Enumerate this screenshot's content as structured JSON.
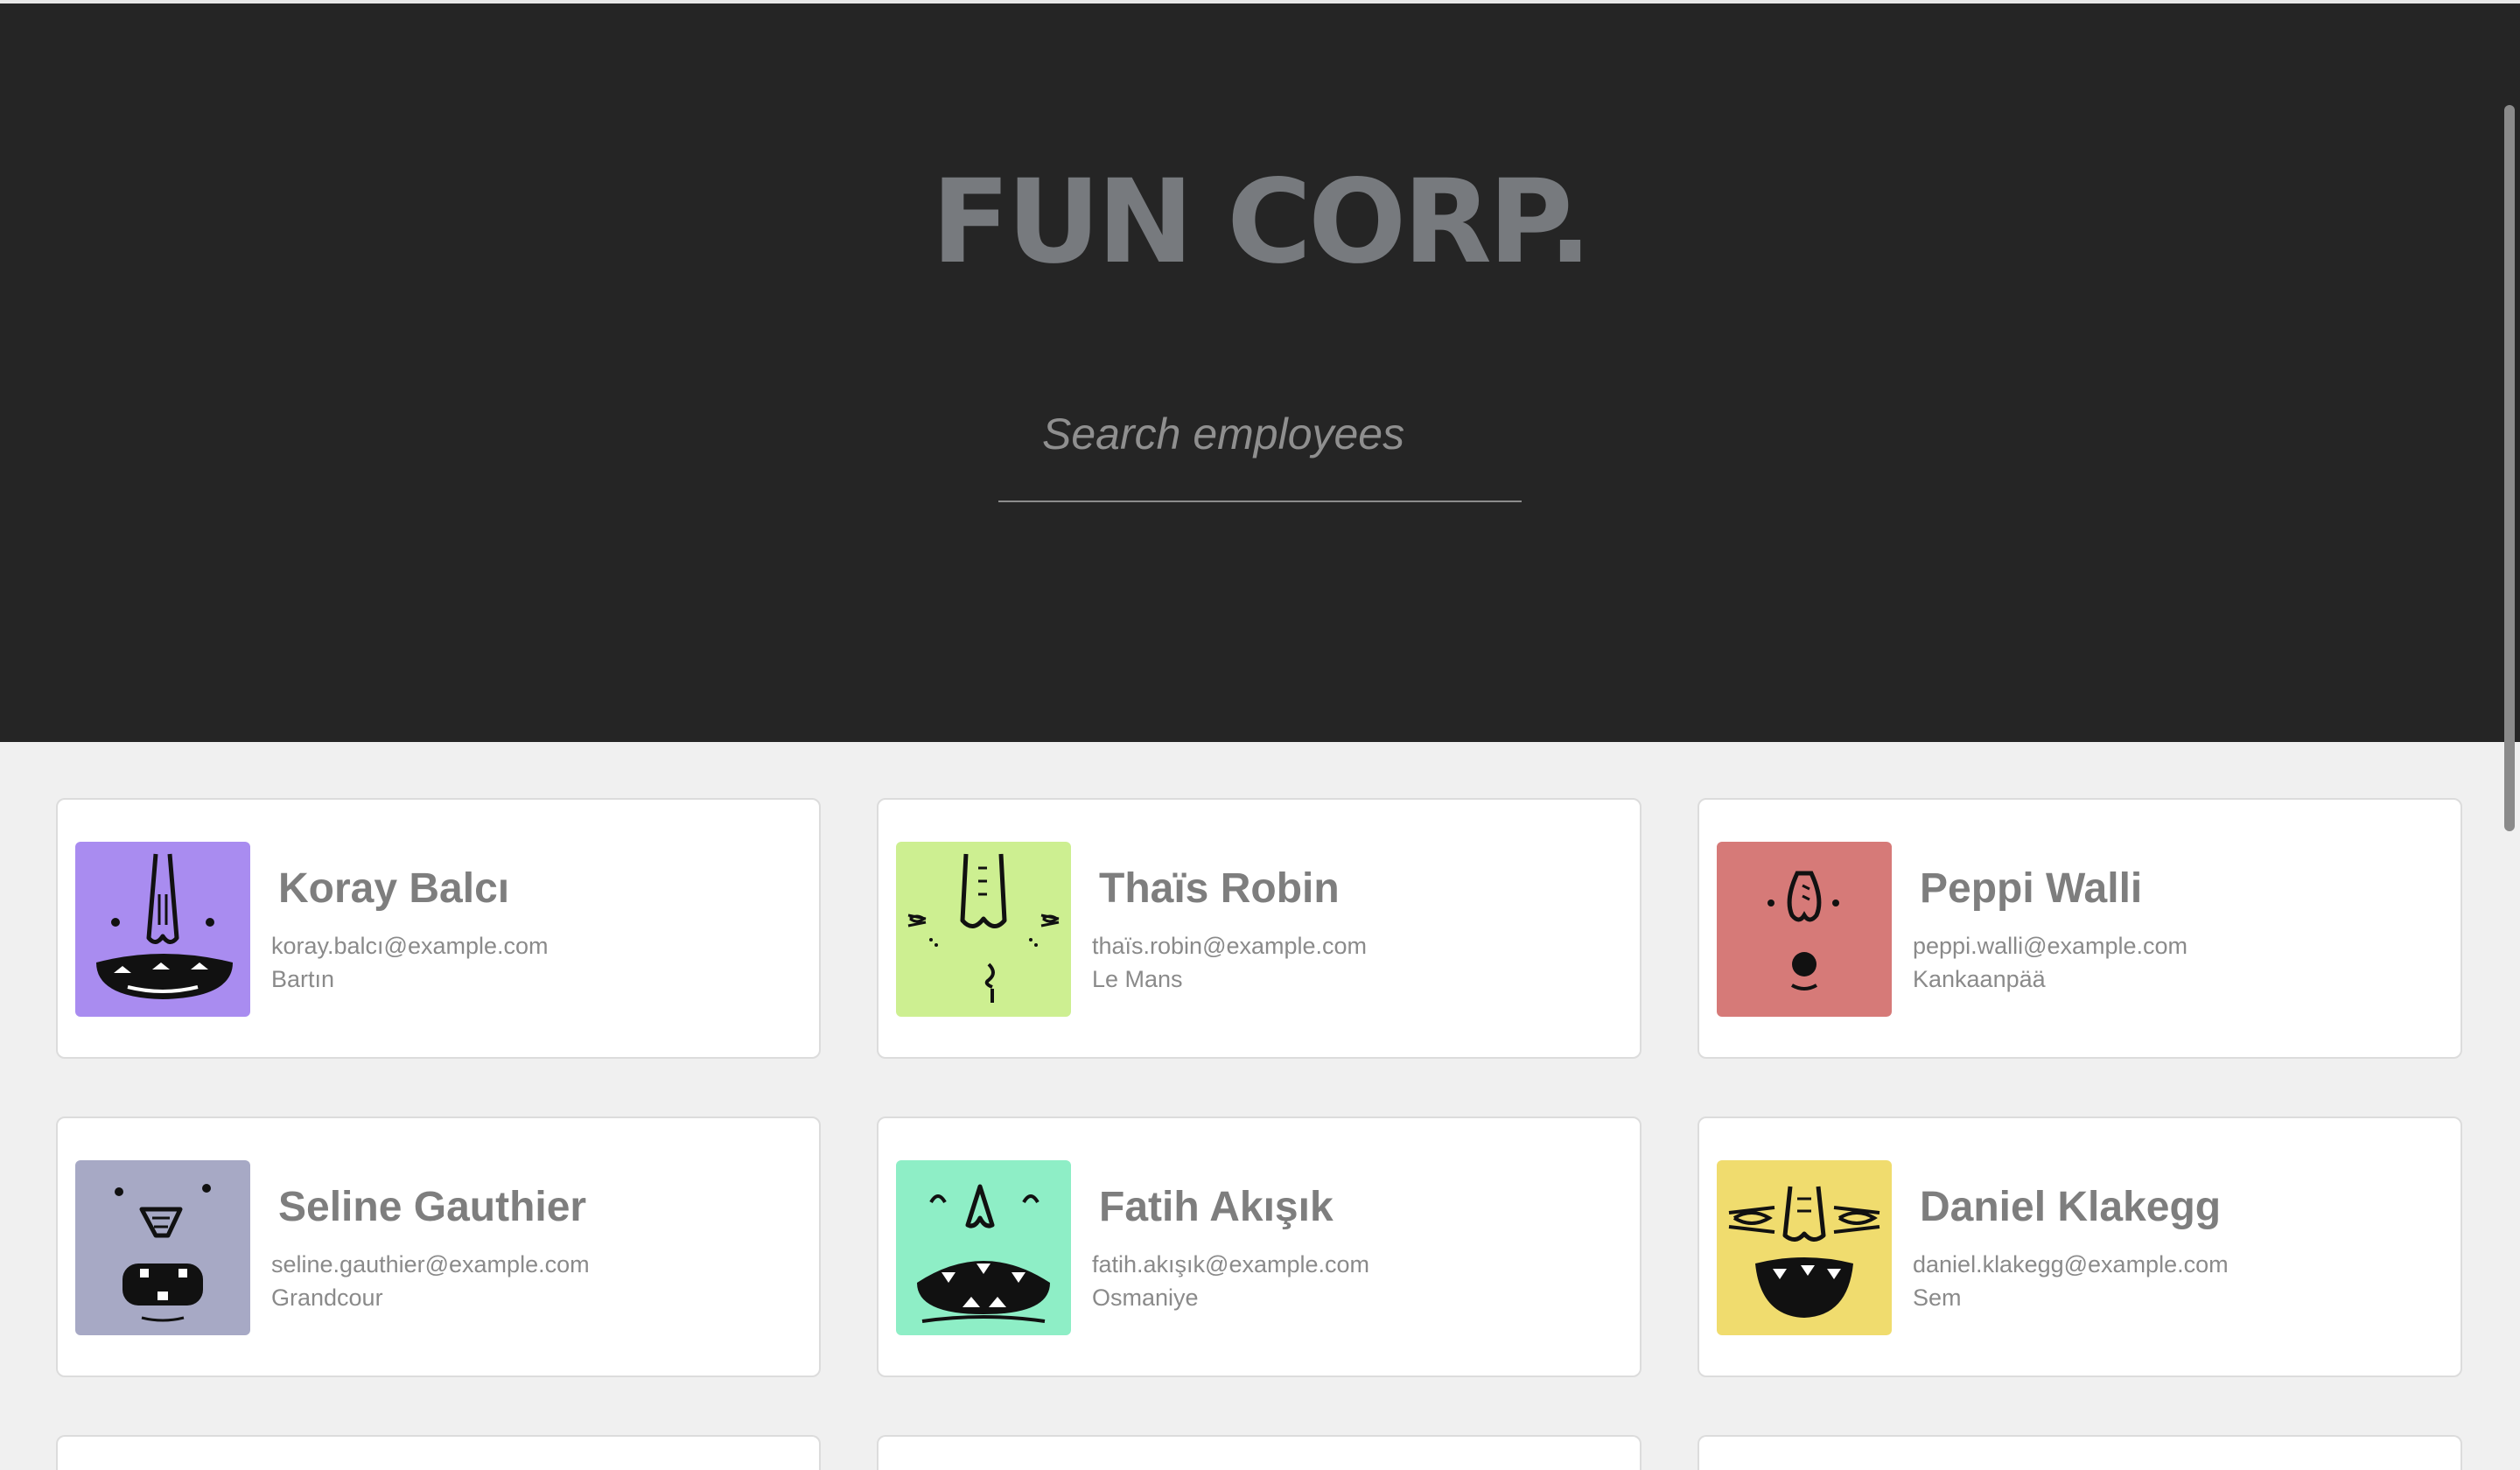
{
  "header": {
    "logo": "FUN CORP.",
    "search_placeholder": "Search employees"
  },
  "employees": [
    {
      "name": "Koray Balcı",
      "email": "koray.balcı@example.com",
      "city": "Bartın",
      "avatar_color": "#a98cf0",
      "avatar_icon": "monster-face-icon"
    },
    {
      "name": "Thaïs Robin",
      "email": "thaïs.robin@example.com",
      "city": "Le Mans",
      "avatar_color": "#cdef91",
      "avatar_icon": "monster-face-icon"
    },
    {
      "name": "Peppi Walli",
      "email": "peppi.walli@example.com",
      "city": "Kankaanpää",
      "avatar_color": "#d67a78",
      "avatar_icon": "monster-face-icon"
    },
    {
      "name": "Seline Gauthier",
      "email": "seline.gauthier@example.com",
      "city": "Grandcour",
      "avatar_color": "#a7a9c5",
      "avatar_icon": "monster-face-icon"
    },
    {
      "name": "Fatih Akışık",
      "email": "fatih.akışık@example.com",
      "city": "Osmaniye",
      "avatar_color": "#8eeec6",
      "avatar_icon": "monster-face-icon"
    },
    {
      "name": "Daniel Klakegg",
      "email": "daniel.klakegg@example.com",
      "city": "Sem",
      "avatar_color": "#f0dc6e",
      "avatar_icon": "monster-face-icon"
    }
  ]
}
